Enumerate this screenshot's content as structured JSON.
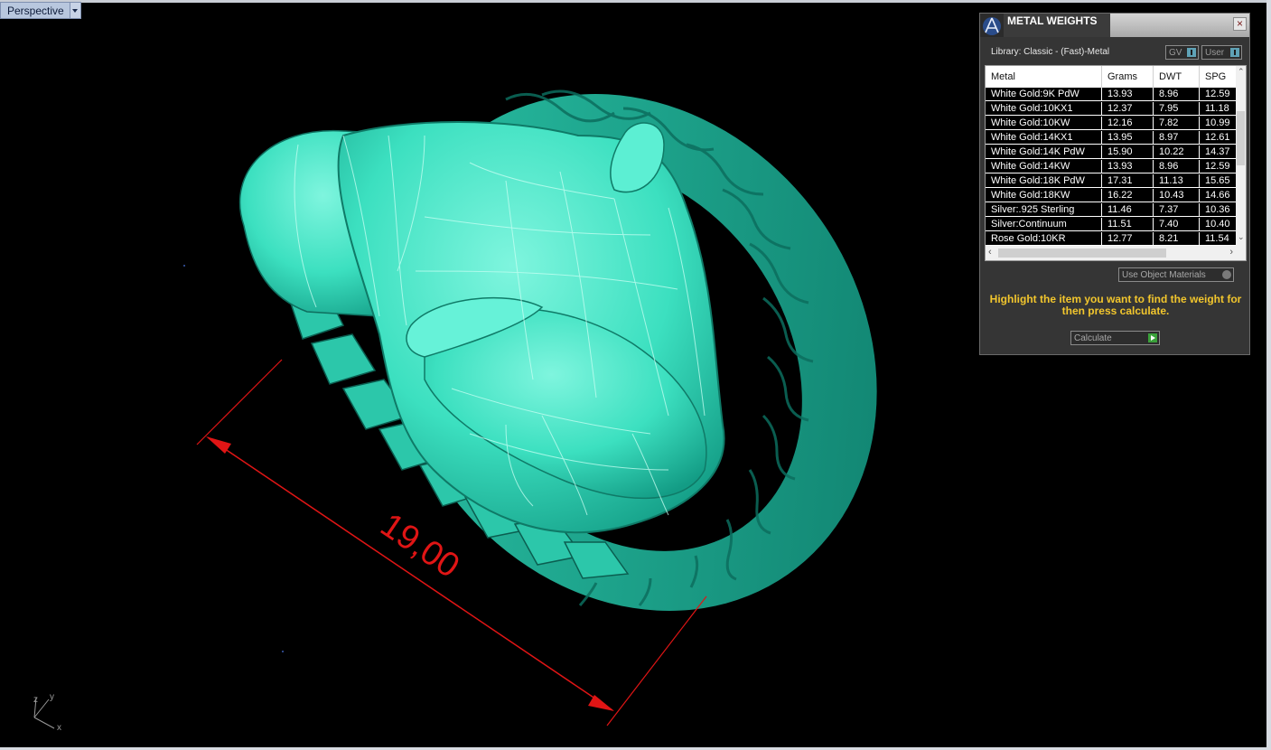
{
  "viewport": {
    "name": "Perspective"
  },
  "dimension": {
    "text": "19,00",
    "color": "#e01515"
  },
  "model": {
    "color": "#3ce0c0"
  },
  "axis": {
    "x": "x",
    "y": "y",
    "z": "z"
  },
  "panel": {
    "title": "METAL WEIGHTS",
    "library": "Library: Classic - (Fast)-Metal",
    "toggle_gv": "GV",
    "toggle_user": "User",
    "columns": [
      "Metal",
      "Grams",
      "DWT",
      "SPG"
    ],
    "rows": [
      [
        "White Gold:9K PdW",
        "13.93",
        "8.96",
        "12.59"
      ],
      [
        "White Gold:10KX1",
        "12.37",
        "7.95",
        "11.18"
      ],
      [
        "White Gold:10KW",
        "12.16",
        "7.82",
        "10.99"
      ],
      [
        "White Gold:14KX1",
        "13.95",
        "8.97",
        "12.61"
      ],
      [
        "White Gold:14K PdW",
        "15.90",
        "10.22",
        "14.37"
      ],
      [
        "White Gold:14KW",
        "13.93",
        "8.96",
        "12.59"
      ],
      [
        "White Gold:18K PdW",
        "17.31",
        "11.13",
        "15.65"
      ],
      [
        "White Gold:18KW",
        "16.22",
        "10.43",
        "14.66"
      ],
      [
        "Silver:.925 Sterling",
        "11.46",
        "7.37",
        "10.36"
      ],
      [
        "Silver:Continuum",
        "11.51",
        "7.40",
        "10.40"
      ],
      [
        "Rose Gold:10KR",
        "12.77",
        "8.21",
        "11.54"
      ]
    ],
    "use_object_materials": "Use Object Materials",
    "hint": "Highlight the item you want to find the weight for then press calculate.",
    "calculate": "Calculate",
    "accent": "#f2c62d"
  }
}
